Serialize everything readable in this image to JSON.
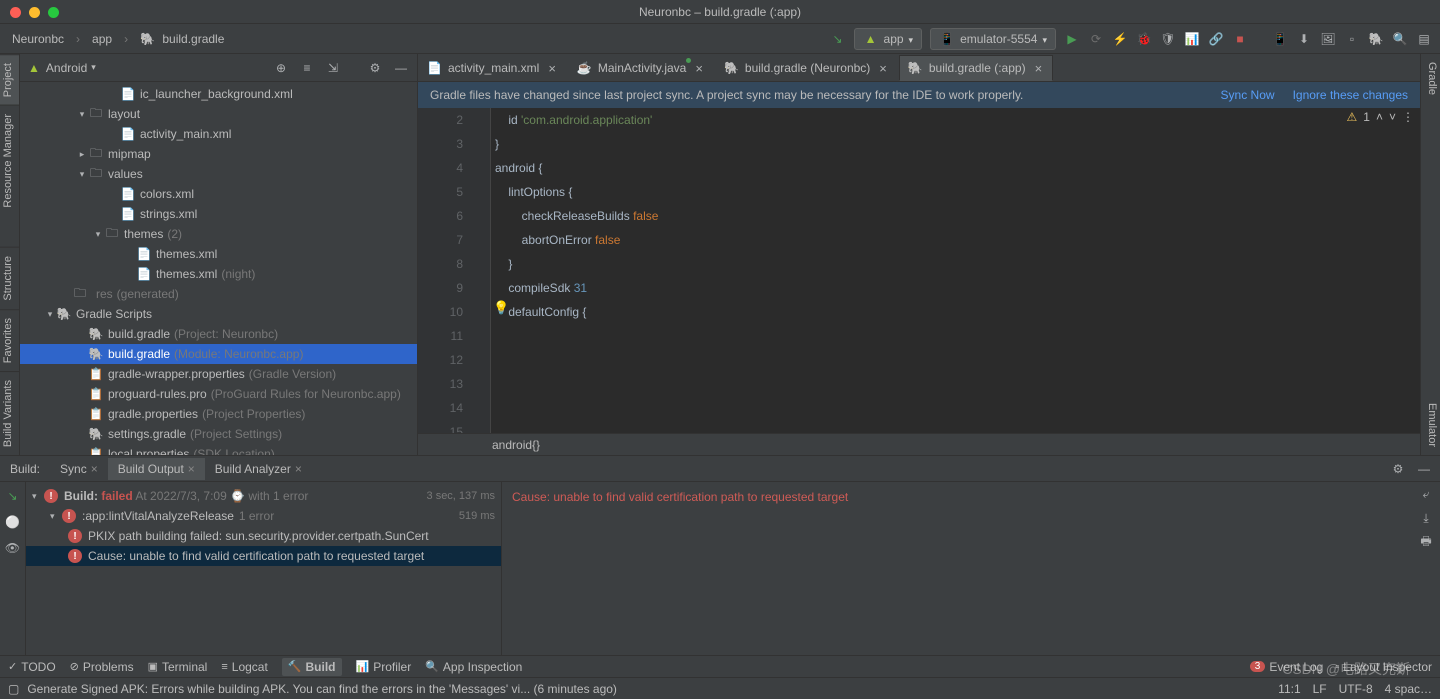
{
  "window": {
    "title": "Neuronbc – build.gradle (:app)"
  },
  "breadcrumb": [
    "Neuronbc",
    "app",
    "build.gradle"
  ],
  "runConfig": {
    "hammer": "⚒",
    "app": "app",
    "device": "emulator-5554"
  },
  "leftTabs": {
    "project": "Project",
    "resmgr": "Resource Manager",
    "structure": "Structure",
    "favorites": "Favorites",
    "buildvar": "Build Variants"
  },
  "rightTabs": {
    "gradle": "Gradle",
    "emulator": "Emulator"
  },
  "projHeader": {
    "label": "Android"
  },
  "tree": [
    {
      "depth": 5,
      "icon": "xml",
      "label": "ic_launcher_background.xml"
    },
    {
      "depth": 3,
      "arrow": "v",
      "icon": "folder",
      "label": "layout"
    },
    {
      "depth": 5,
      "icon": "xml",
      "label": "activity_main.xml"
    },
    {
      "depth": 3,
      "arrow": ">",
      "icon": "folder",
      "label": "mipmap"
    },
    {
      "depth": 3,
      "arrow": "v",
      "icon": "folder",
      "label": "values"
    },
    {
      "depth": 5,
      "icon": "xml",
      "label": "colors.xml"
    },
    {
      "depth": 5,
      "icon": "xml",
      "label": "strings.xml"
    },
    {
      "depth": 4,
      "arrow": "v",
      "icon": "folder",
      "label": "themes",
      "suffix": "(2)"
    },
    {
      "depth": 6,
      "icon": "xml",
      "label": "themes.xml"
    },
    {
      "depth": 6,
      "icon": "xml",
      "label": "themes.xml",
      "suffix": "(night)"
    },
    {
      "depth": 2,
      "icon": "folder",
      "label": "res",
      "suffix": "(generated)",
      "dimlabel": true
    },
    {
      "depth": 1,
      "arrow": "v",
      "icon": "gradle",
      "label": "Gradle Scripts"
    },
    {
      "depth": 3,
      "icon": "gradle",
      "label": "build.gradle",
      "suffix": "(Project: Neuronbc)"
    },
    {
      "depth": 3,
      "icon": "gradle",
      "label": "build.gradle",
      "suffix": "(Module: Neuronbc.app)",
      "sel": true
    },
    {
      "depth": 3,
      "icon": "prop",
      "label": "gradle-wrapper.properties",
      "suffix": "(Gradle Version)"
    },
    {
      "depth": 3,
      "icon": "prop",
      "label": "proguard-rules.pro",
      "suffix": "(ProGuard Rules for Neuronbc.app)"
    },
    {
      "depth": 3,
      "icon": "prop",
      "label": "gradle.properties",
      "suffix": "(Project Properties)"
    },
    {
      "depth": 3,
      "icon": "gradle",
      "label": "settings.gradle",
      "suffix": "(Project Settings)"
    },
    {
      "depth": 3,
      "icon": "prop",
      "label": "local.properties",
      "suffix": "(SDK Location)"
    }
  ],
  "editorTabs": [
    {
      "label": "activity_main.xml",
      "icon": "xml"
    },
    {
      "label": "MainActivity.java",
      "icon": "java",
      "dot": true
    },
    {
      "label": "build.gradle (Neuronbc)",
      "icon": "gradle"
    },
    {
      "label": "build.gradle (:app)",
      "icon": "gradle",
      "active": true
    }
  ],
  "banner": {
    "msg": "Gradle files have changed since last project sync. A project sync may be necessary for the IDE to work properly.",
    "sync": "Sync Now",
    "ignore": "Ignore these changes"
  },
  "warnings": {
    "count": "1"
  },
  "code": {
    "start": 2,
    "lines": [
      "    id 'com.android.application'",
      "}",
      "",
      "android {",
      "",
      "    lintOptions {",
      "        checkReleaseBuilds false",
      "        abortOnError false",
      "    }",
      "",
      "",
      "    compileSdk 31",
      "",
      "    defaultConfig {"
    ]
  },
  "editorCrumb": "android{}",
  "buildPanel": {
    "label": "Build:",
    "tabs": [
      {
        "label": "Sync"
      },
      {
        "label": "Build Output",
        "active": true
      },
      {
        "label": "Build Analyzer"
      }
    ],
    "rows": [
      {
        "depth": 0,
        "arrow": "v",
        "boldlabel": "Build:",
        "boldval": "failed",
        "suffix": " At 2022/7/3, 7:09 ⌚ with 1 error",
        "time": "3 sec, 137 ms"
      },
      {
        "depth": 1,
        "arrow": "v",
        "label": ":app:lintVitalAnalyzeRelease",
        "count": "1 error",
        "time": "519 ms"
      },
      {
        "depth": 2,
        "label": "PKIX path building failed: sun.security.provider.certpath.SunCert"
      },
      {
        "depth": 2,
        "label": "Cause: unable to find valid certification path to requested target",
        "sel": true
      }
    ],
    "output": "Cause: unable to find valid certification path to requested target"
  },
  "toolwins": {
    "todo": "TODO",
    "problems": "Problems",
    "terminal": "Terminal",
    "logcat": "Logcat",
    "build": "Build",
    "profiler": "Profiler",
    "appinsp": "App Inspection",
    "eventlog": "Event Log",
    "layoutinsp": "Layout Inspector",
    "badge": "3"
  },
  "status": {
    "msg": "Generate Signed APK: Errors while building APK. You can find the errors in the 'Messages' vi... (6 minutes ago)",
    "pos": "11:1",
    "sep": "LF",
    "enc": "UTF-8",
    "indent": "4 spac…"
  },
  "watermark": "CSDN @电路又克斯"
}
